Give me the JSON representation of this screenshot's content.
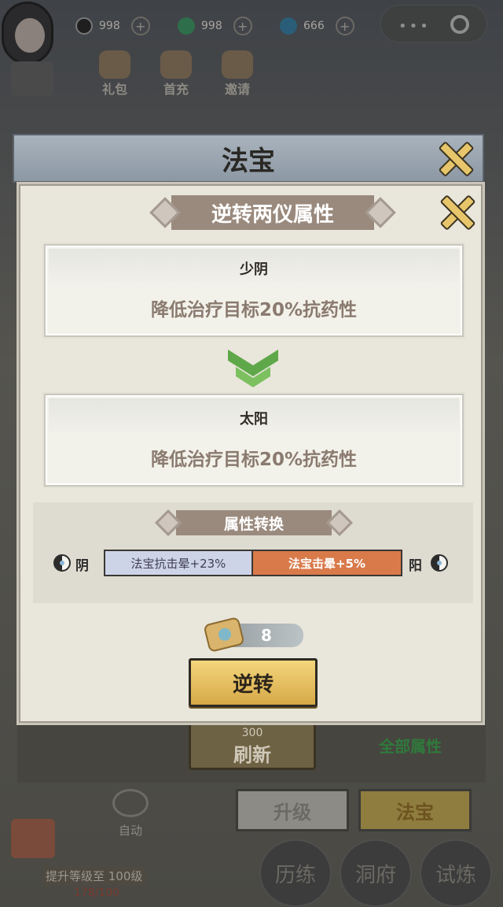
{
  "hud": {
    "currency": [
      {
        "icon": "yinyang-coin-icon",
        "value": "998",
        "add": "+"
      },
      {
        "icon": "jade-icon",
        "value": "998",
        "add": "+"
      },
      {
        "icon": "spirit-stone-icon",
        "value": "666",
        "add": "+"
      }
    ],
    "capsule": {
      "dots": "•••"
    }
  },
  "menu": [
    {
      "icon": "gift-bag-icon",
      "label": "礼包"
    },
    {
      "icon": "first-charge-icon",
      "label": "首充"
    },
    {
      "icon": "invite-scroll-icon",
      "label": "邀请"
    }
  ],
  "window": {
    "title": "法宝"
  },
  "modal": {
    "title": "逆转两仪属性",
    "from": {
      "name": "少阴",
      "desc": "降低治疗目标20%抗药性"
    },
    "to": {
      "name": "太阳",
      "desc": "降低治疗目标20%抗药性"
    },
    "conversion": {
      "title": "属性转换",
      "yin_label": "阴",
      "yang_label": "阳",
      "yin_value": "法宝抗击晕+23%",
      "yang_value": "法宝击晕+5%"
    },
    "cost": {
      "icon": "scroll-item-icon",
      "amount": "8"
    },
    "confirm_label": "逆转"
  },
  "background": {
    "refresh": {
      "cost": "300",
      "label": "刷新"
    },
    "all_attributes": "全部属性",
    "tabs": [
      {
        "label": "升级"
      },
      {
        "label": "法宝"
      }
    ],
    "auto_label": "自动",
    "quest": {
      "text": "提升等级至 100级",
      "progress": "178/100"
    },
    "round_buttons": [
      {
        "label": "历练"
      },
      {
        "label": "洞府"
      },
      {
        "label": "试炼"
      }
    ]
  },
  "colors": {
    "yin_bar": "#ced4e8",
    "yang_bar": "#d97a4a",
    "confirm_button": "#e8c262",
    "arrow": "#5fa84a",
    "banner": "#9a8a7e"
  }
}
